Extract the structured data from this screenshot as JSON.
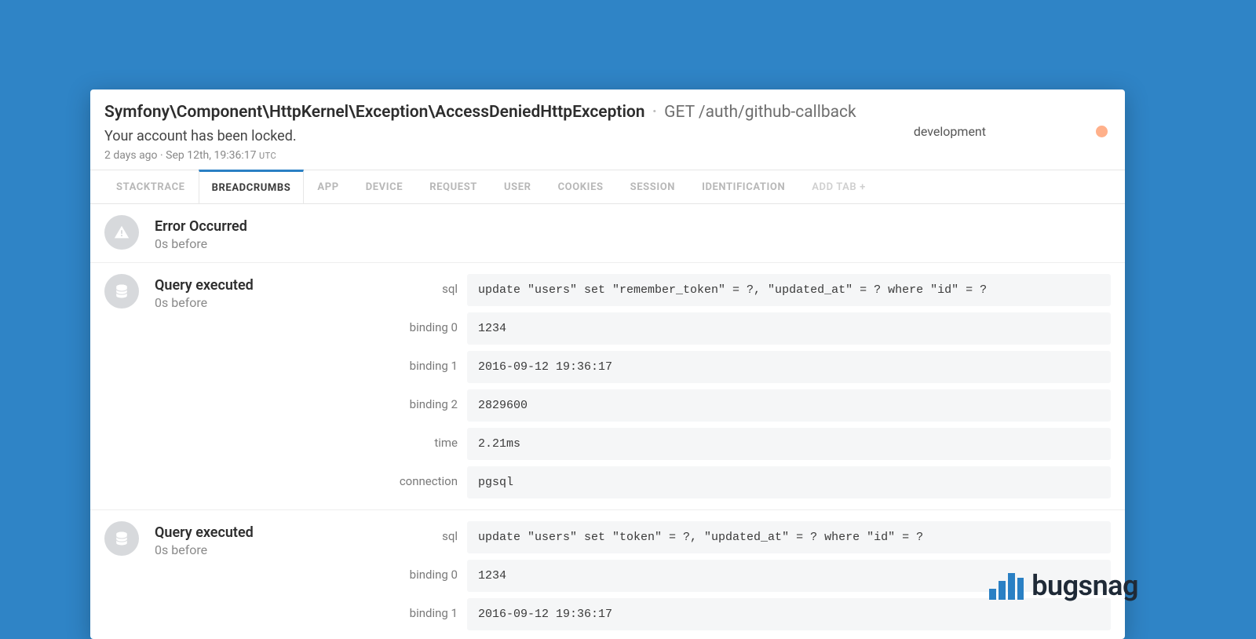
{
  "header": {
    "exception": "Symfony\\Component\\HttpKernel\\Exception\\AccessDeniedHttpException",
    "request": "GET /auth/github-callback",
    "message": "Your account has been locked.",
    "relative_time": "2 days ago",
    "timestamp": "Sep 12th, 19:36:17",
    "timezone": "UTC",
    "environment": "development"
  },
  "tabs": [
    {
      "label": "STACKTRACE",
      "active": false
    },
    {
      "label": "BREADCRUMBS",
      "active": true
    },
    {
      "label": "APP",
      "active": false
    },
    {
      "label": "DEVICE",
      "active": false
    },
    {
      "label": "REQUEST",
      "active": false
    },
    {
      "label": "USER",
      "active": false
    },
    {
      "label": "COOKIES",
      "active": false
    },
    {
      "label": "SESSION",
      "active": false
    },
    {
      "label": "IDENTIFICATION",
      "active": false
    },
    {
      "label": "ADD TAB +",
      "active": false,
      "add": true
    }
  ],
  "breadcrumbs": [
    {
      "icon": "warning-icon",
      "title": "Error Occurred",
      "sub": "0s before",
      "rows": []
    },
    {
      "icon": "database-icon",
      "title": "Query executed",
      "sub": "0s before",
      "rows": [
        {
          "k": "sql",
          "v": "update \"users\" set \"remember_token\" = ?, \"updated_at\" = ? where \"id\" = ?"
        },
        {
          "k": "binding 0",
          "v": "1234"
        },
        {
          "k": "binding 1",
          "v": "2016-09-12 19:36:17"
        },
        {
          "k": "binding 2",
          "v": "2829600"
        },
        {
          "k": "time",
          "v": "2.21ms"
        },
        {
          "k": "connection",
          "v": "pgsql"
        }
      ]
    },
    {
      "icon": "database-icon",
      "title": "Query executed",
      "sub": "0s before",
      "rows": [
        {
          "k": "sql",
          "v": "update \"users\" set \"token\" = ?, \"updated_at\" = ? where \"id\" = ?"
        },
        {
          "k": "binding 0",
          "v": "1234"
        },
        {
          "k": "binding 1",
          "v": "2016-09-12 19:36:17"
        }
      ]
    }
  ],
  "logo": {
    "text": "bugsnag"
  }
}
